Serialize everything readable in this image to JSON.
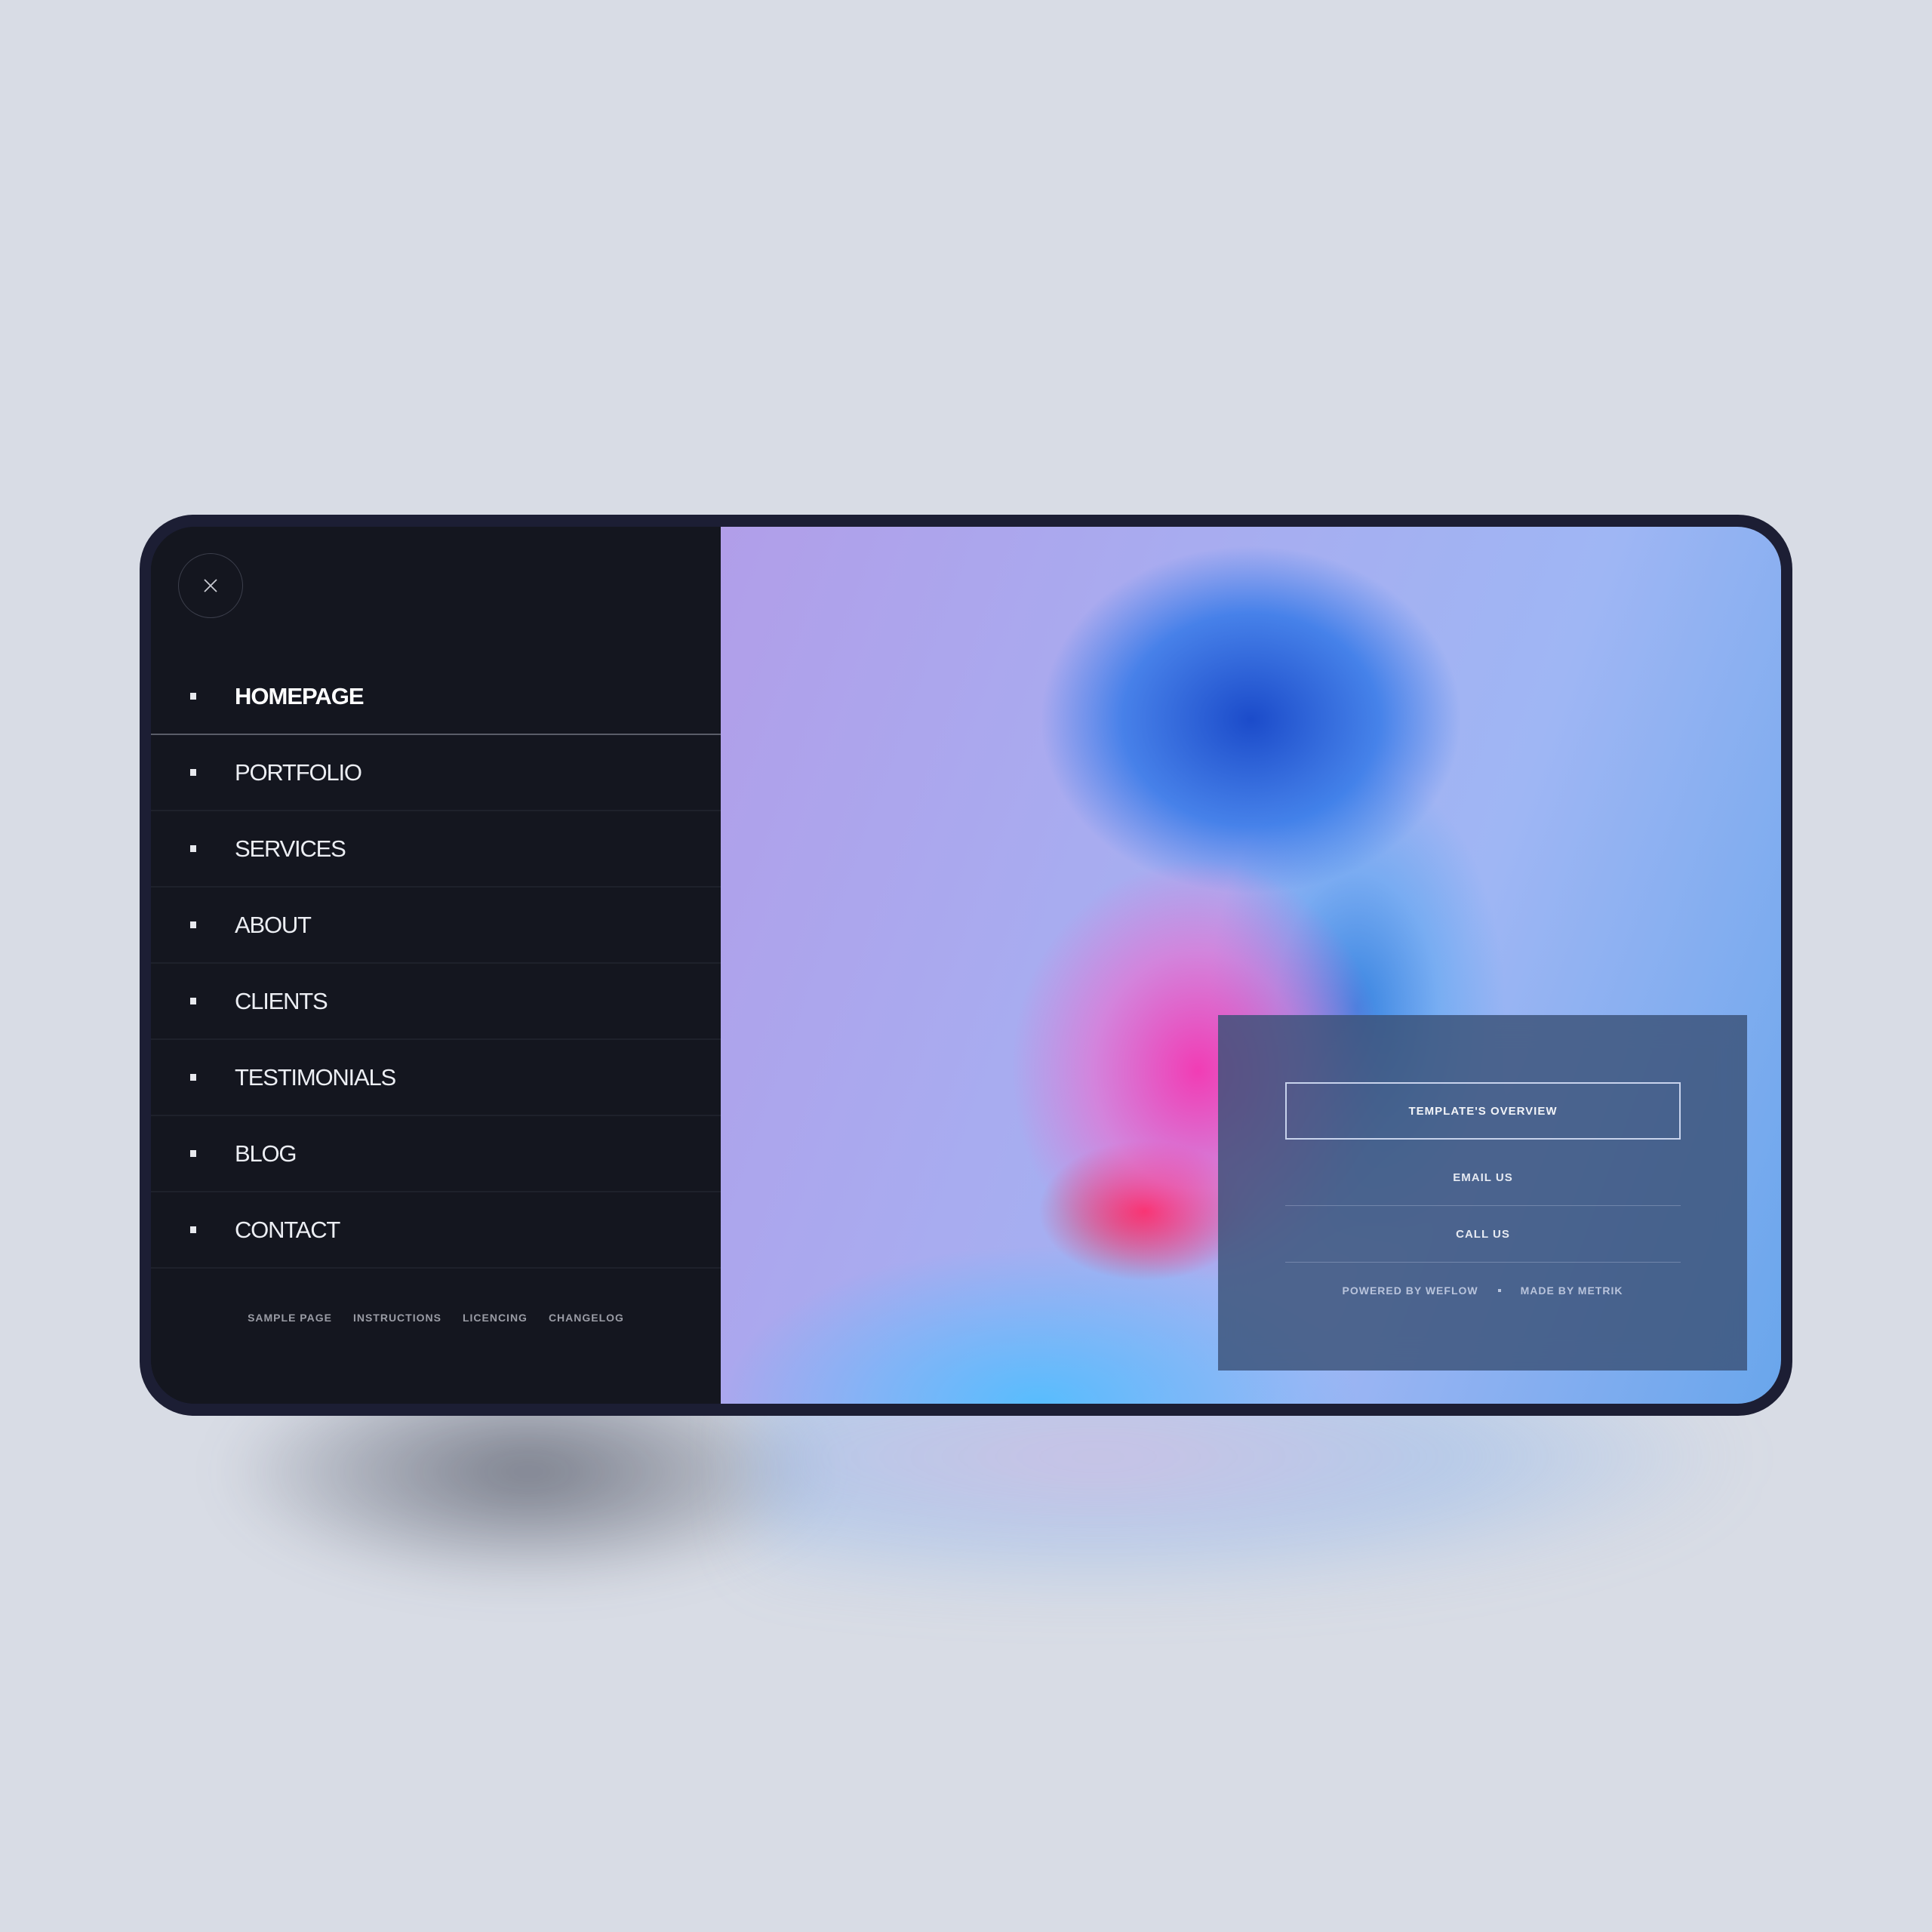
{
  "menu": {
    "close_icon": "close-icon",
    "items": [
      {
        "label": "HOMEPAGE",
        "active": true
      },
      {
        "label": "PORTFOLIO",
        "active": false
      },
      {
        "label": "SERVICES",
        "active": false
      },
      {
        "label": "ABOUT",
        "active": false
      },
      {
        "label": "CLIENTS",
        "active": false
      },
      {
        "label": "TESTIMONIALS",
        "active": false
      },
      {
        "label": "BLOG",
        "active": false
      },
      {
        "label": "CONTACT",
        "active": false
      }
    ],
    "footer_links": [
      "SAMPLE PAGE",
      "INSTRUCTIONS",
      "LICENCING",
      "CHANGELOG"
    ]
  },
  "card": {
    "primary_button": "TEMPLATE'S OVERVIEW",
    "email_label": "EMAIL US",
    "call_label": "CALL US",
    "powered_by": "POWERED BY WEFLOW",
    "made_by": "MADE BY METRIK"
  },
  "colors": {
    "panel_bg": "#14161f",
    "frame": "#1c1e34",
    "page_bg": "#d8dce5"
  }
}
